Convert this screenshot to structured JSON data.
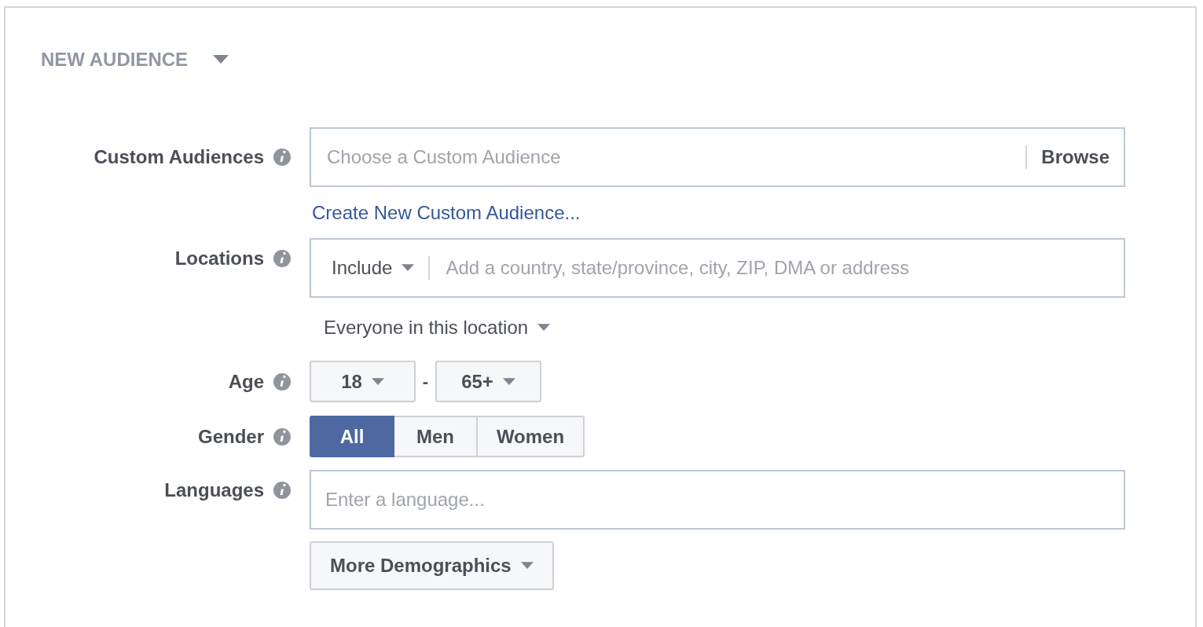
{
  "header": {
    "title": "NEW AUDIENCE"
  },
  "custom_audiences": {
    "label": "Custom Audiences",
    "placeholder": "Choose a Custom Audience",
    "browse": "Browse",
    "link": "Create New Custom Audience..."
  },
  "locations": {
    "label": "Locations",
    "include": "Include",
    "placeholder": "Add a country, state/province, city, ZIP, DMA or address",
    "audience": "Everyone in this location"
  },
  "age": {
    "label": "Age",
    "min": "18",
    "separator": "-",
    "max": "65+"
  },
  "gender": {
    "label": "Gender",
    "options": [
      {
        "label": "All",
        "selected": true
      },
      {
        "label": "Men",
        "selected": false
      },
      {
        "label": "Women",
        "selected": false
      }
    ]
  },
  "languages": {
    "label": "Languages",
    "placeholder": "Enter a language..."
  },
  "more_button": "More Demographics"
}
